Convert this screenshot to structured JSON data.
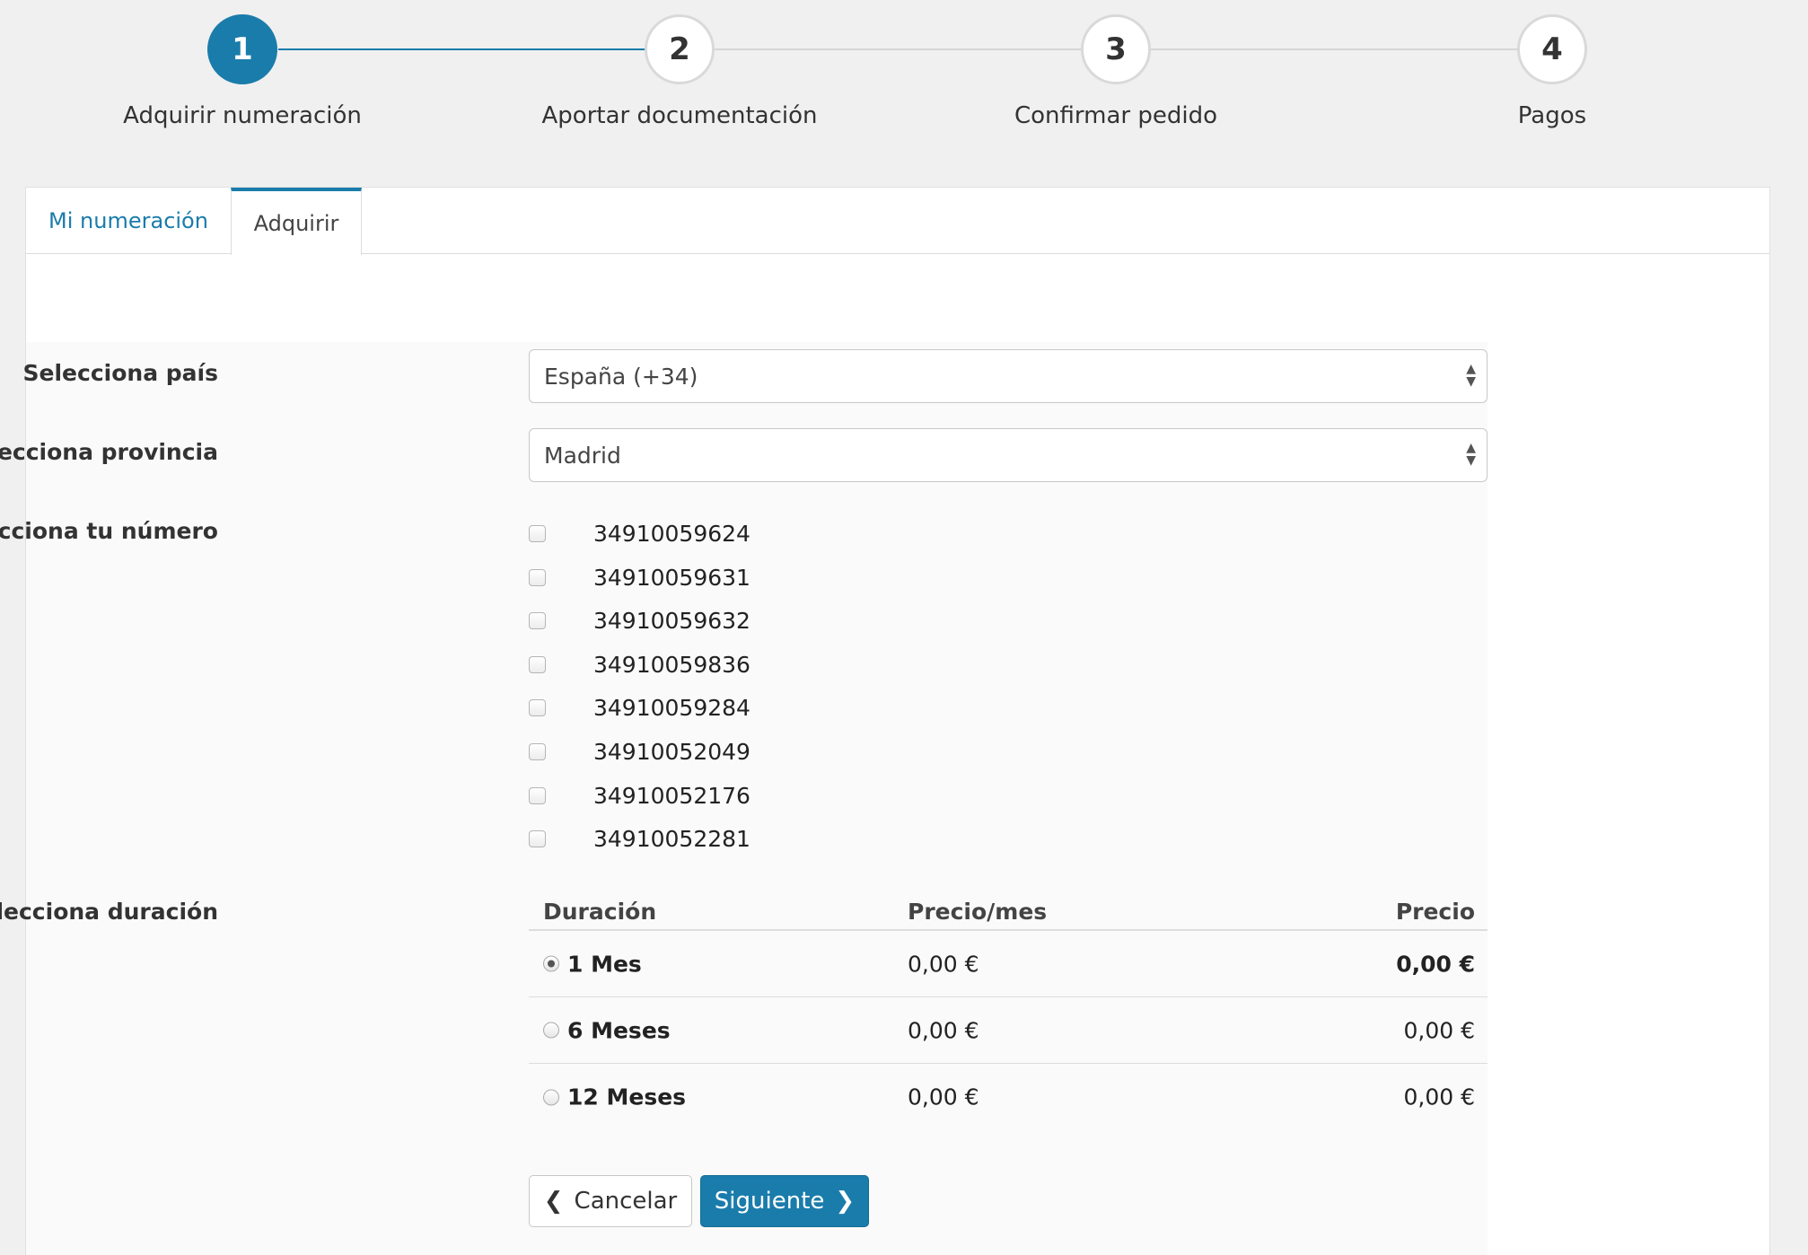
{
  "stepper": {
    "steps": [
      {
        "number": "1",
        "label": "Adquirir numeración",
        "active": true
      },
      {
        "number": "2",
        "label": "Aportar documentación",
        "active": false
      },
      {
        "number": "3",
        "label": "Confirmar pedido",
        "active": false
      },
      {
        "number": "4",
        "label": "Pagos",
        "active": false
      }
    ]
  },
  "tabs": {
    "my_numbers": "Mi numeración",
    "acquire": "Adquirir"
  },
  "form": {
    "country_label": "Selecciona país",
    "country_value": "España (+34)",
    "province_label": "Selecciona provincia",
    "province_value": "Madrid",
    "number_label": "Selecciona tu número",
    "numbers": [
      "34910059624",
      "34910059631",
      "34910059632",
      "34910059836",
      "34910059284",
      "34910052049",
      "34910052176",
      "34910052281"
    ],
    "duration_label": "Selecciona duración",
    "duration_table": {
      "headers": {
        "duration": "Duración",
        "price_month": "Precio/mes",
        "price": "Precio"
      },
      "rows": [
        {
          "duration": "1 Mes",
          "price_month": "0,00 €",
          "price": "0,00 €",
          "selected": true
        },
        {
          "duration": "6 Meses",
          "price_month": "0,00 €",
          "price": "0,00 €",
          "selected": false
        },
        {
          "duration": "12 Meses",
          "price_month": "0,00 €",
          "price": "0,00 €",
          "selected": false
        }
      ]
    }
  },
  "buttons": {
    "cancel": "Cancelar",
    "next": "Siguiente"
  },
  "colors": {
    "accent": "#1a7cab"
  },
  "icons": {
    "select_arrows": "sort-arrows-icon",
    "back": "chevron-left-icon",
    "forward": "chevron-right-icon"
  }
}
